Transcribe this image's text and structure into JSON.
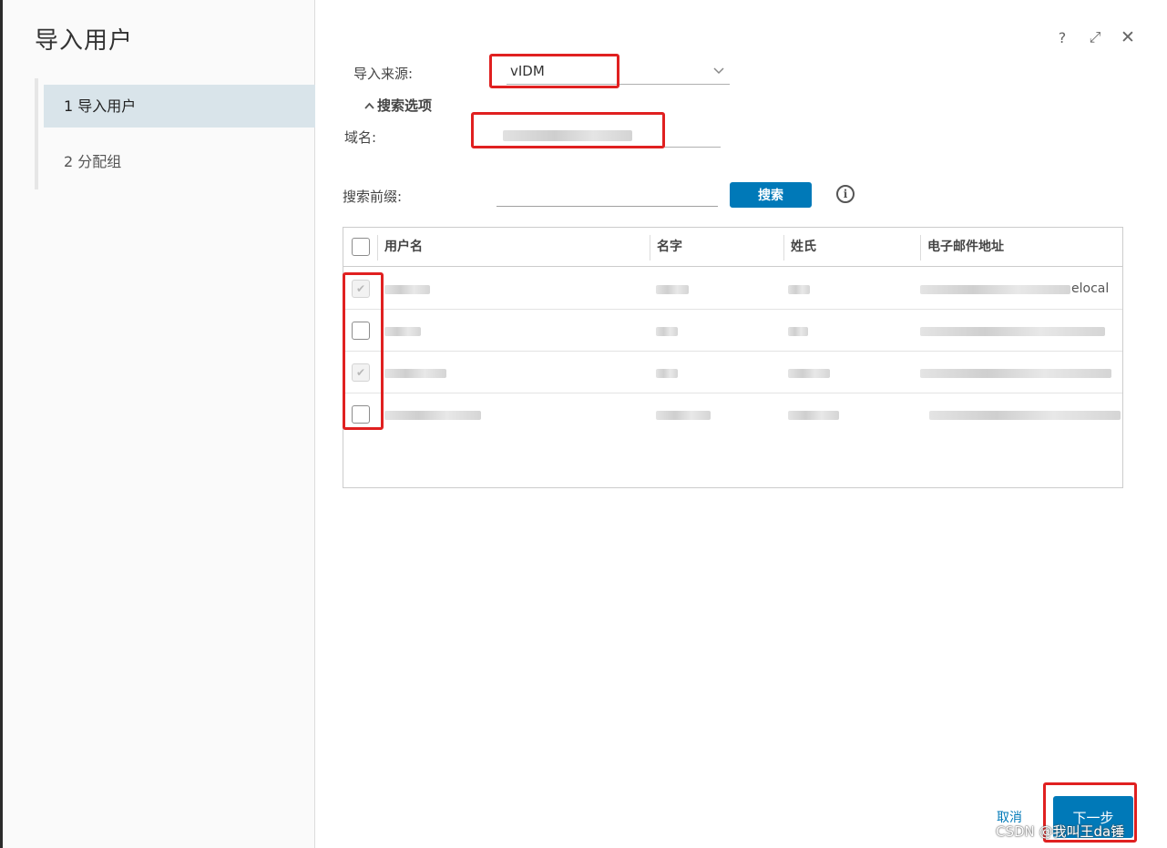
{
  "wizard": {
    "title": "导入用户",
    "steps": [
      {
        "label": "1 导入用户",
        "active": true
      },
      {
        "label": "2 分配组",
        "active": false
      }
    ]
  },
  "header_icons": [
    "help-icon",
    "expand-icon",
    "close-icon"
  ],
  "header_glyphs": {
    "help": "?",
    "expand": "⤢",
    "close": "✕"
  },
  "form": {
    "source_label": "导入来源:",
    "source_value": "vIDM",
    "search_options_label": "搜索选项",
    "domain_label": "域名:",
    "domain_value": "",
    "prefix_label": "搜索前缀:",
    "prefix_value": "",
    "search_button": "搜索",
    "info_glyph": "i"
  },
  "table": {
    "columns": [
      "用户名",
      "名字",
      "姓氏",
      "电子邮件地址"
    ],
    "rows": [
      {
        "checked": true,
        "disabled": true,
        "email_suffix": "elocal"
      },
      {
        "checked": false,
        "disabled": false,
        "email_suffix": ""
      },
      {
        "checked": true,
        "disabled": true,
        "email_suffix": ""
      },
      {
        "checked": false,
        "disabled": false,
        "email_suffix": ""
      }
    ]
  },
  "footer": {
    "cancel": "取消",
    "next": "下一步"
  },
  "watermark": "CSDN @我叫王da锤",
  "colors": {
    "primary": "#0079b8",
    "active_step_bg": "#d9e4ea",
    "highlight": "#e02020"
  }
}
